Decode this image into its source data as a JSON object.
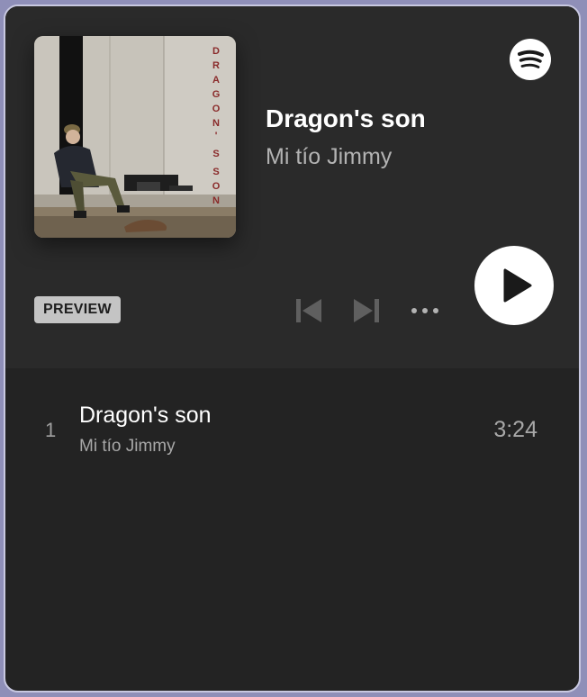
{
  "player": {
    "track_title": "Dragon's son",
    "artist": "Mi tío Jimmy",
    "preview_label": "PREVIEW",
    "cover_text": "DRAGON'S SON"
  },
  "controls": {
    "prev_icon": "skip-back-icon",
    "next_icon": "skip-forward-icon",
    "more_icon": "more-options-icon",
    "play_icon": "play-icon"
  },
  "tracklist": [
    {
      "number": "1",
      "title": "Dragon's son",
      "artist": "Mi tío Jimmy",
      "duration": "3:24"
    }
  ],
  "colors": {
    "background": "#232323",
    "header_background": "#2a2a2a",
    "primary_text": "#ffffff",
    "secondary_text": "#b3b3b3",
    "badge_background": "#c4c4c4"
  }
}
